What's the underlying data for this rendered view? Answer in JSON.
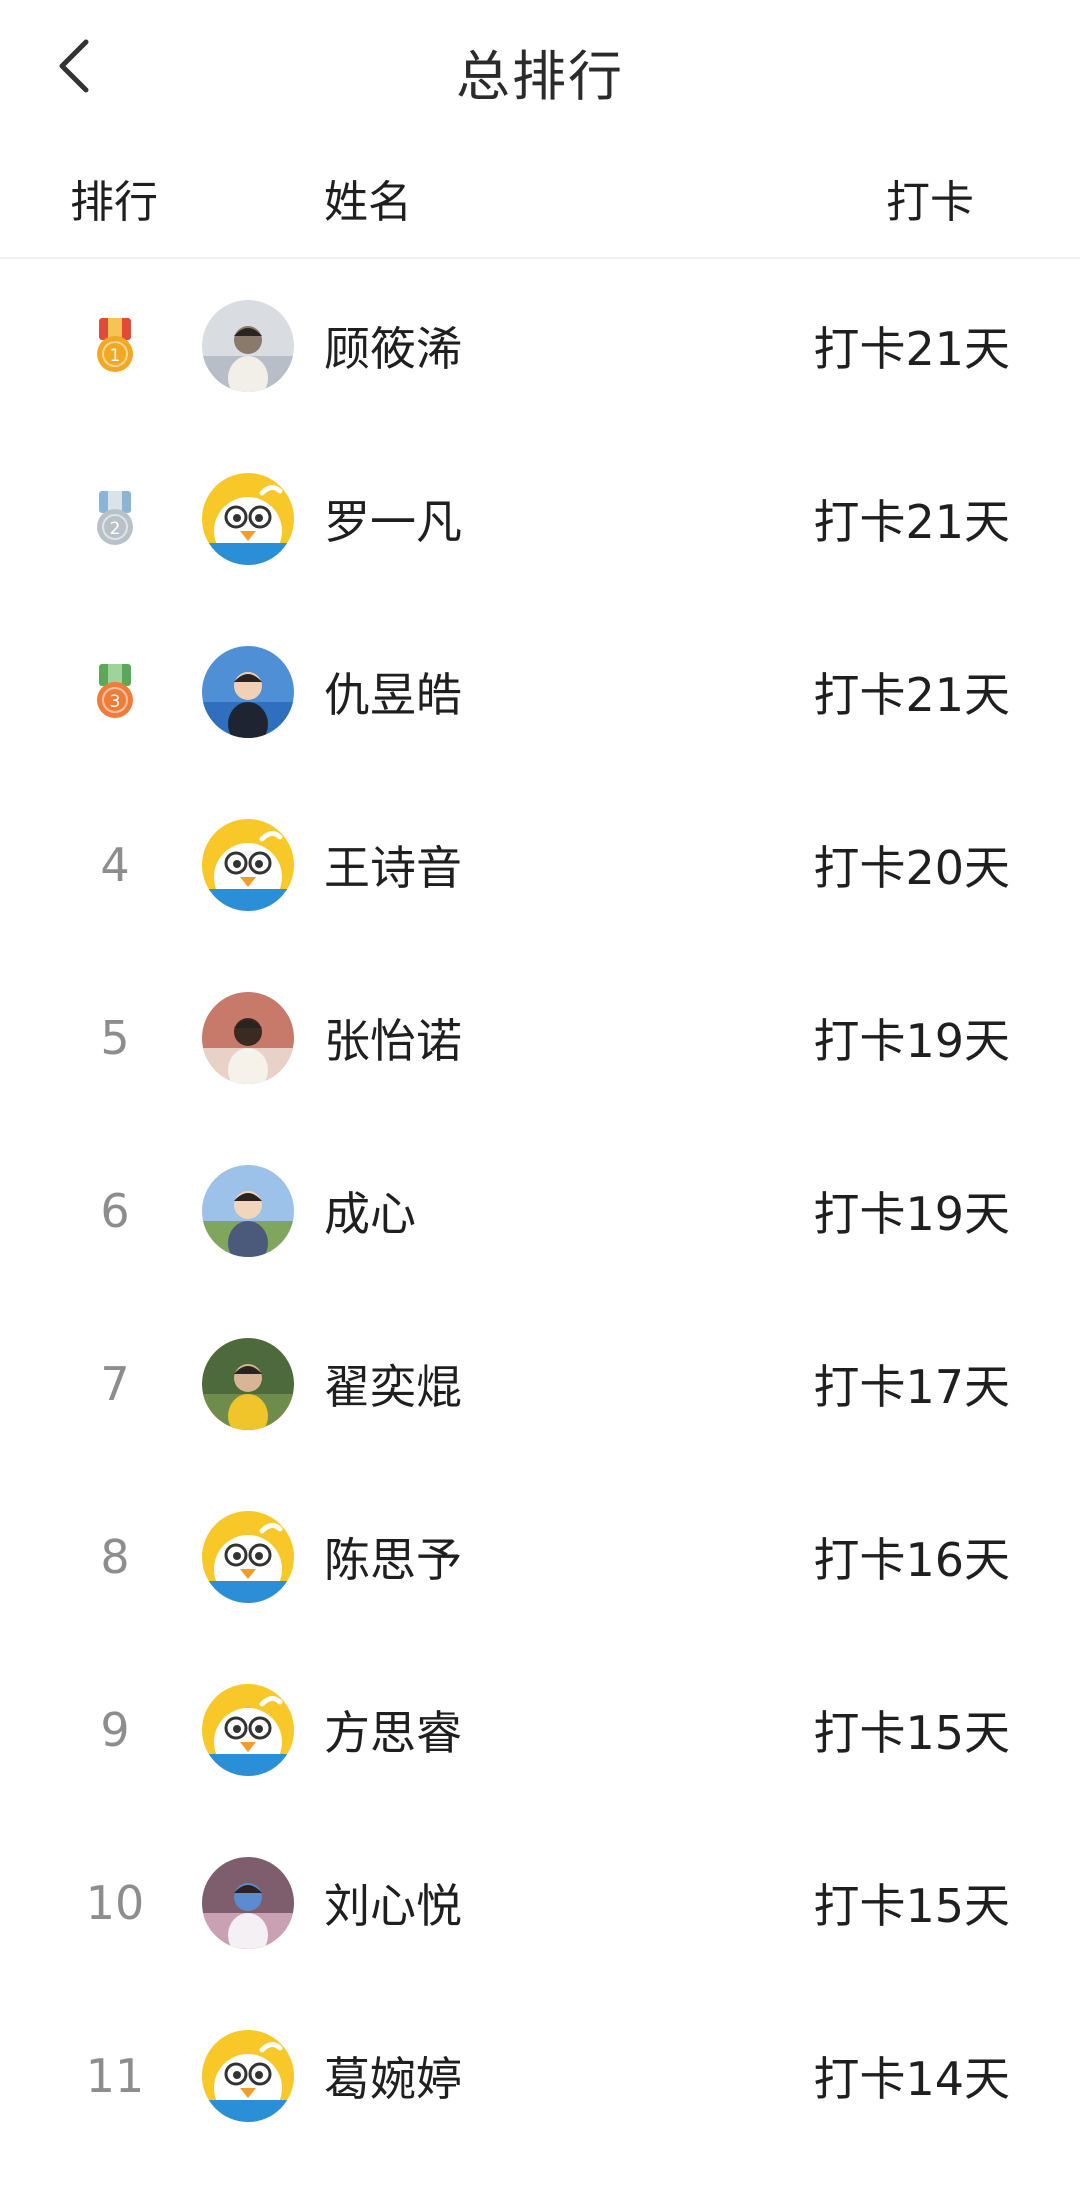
{
  "header": {
    "title": "总排行",
    "back_icon": "chevron-left-icon"
  },
  "columns": {
    "rank": "排行",
    "name": "姓名",
    "checkin": "打卡"
  },
  "rows": [
    {
      "rank": "1",
      "medal": "gold",
      "name": "顾筱浠",
      "checkin": "打卡21天",
      "avatar": "photo-baby"
    },
    {
      "rank": "2",
      "medal": "silver",
      "name": "罗一凡",
      "checkin": "打卡21天",
      "avatar": "duck"
    },
    {
      "rank": "3",
      "medal": "bronze",
      "name": "仇昱皓",
      "checkin": "打卡21天",
      "avatar": "photo-boy-blue"
    },
    {
      "rank": "4",
      "medal": "",
      "name": "王诗音",
      "checkin": "打卡20天",
      "avatar": "duck"
    },
    {
      "rank": "5",
      "medal": "",
      "name": "张怡诺",
      "checkin": "打卡19天",
      "avatar": "photo-girl-red"
    },
    {
      "rank": "6",
      "medal": "",
      "name": "成心",
      "checkin": "打卡19天",
      "avatar": "photo-outdoor"
    },
    {
      "rank": "7",
      "medal": "",
      "name": "翟奕焜",
      "checkin": "打卡17天",
      "avatar": "photo-yellow-shirt"
    },
    {
      "rank": "8",
      "medal": "",
      "name": "陈思予",
      "checkin": "打卡16天",
      "avatar": "duck"
    },
    {
      "rank": "9",
      "medal": "",
      "name": "方思睿",
      "checkin": "打卡15天",
      "avatar": "duck"
    },
    {
      "rank": "10",
      "medal": "",
      "name": "刘心悦",
      "checkin": "打卡15天",
      "avatar": "photo-toy"
    },
    {
      "rank": "11",
      "medal": "",
      "name": "葛婉婷",
      "checkin": "打卡14天",
      "avatar": "duck"
    }
  ],
  "colors": {
    "gold": "#f2a820",
    "silver": "#b9c1c8",
    "bronze": "#f07c3a",
    "ribbon_gold": "#e24a3b",
    "ribbon_silver": "#89b6d8",
    "ribbon_bronze": "#5aa95b",
    "duck_bg": "#f7c827",
    "duck_band": "#2b8fd8"
  }
}
